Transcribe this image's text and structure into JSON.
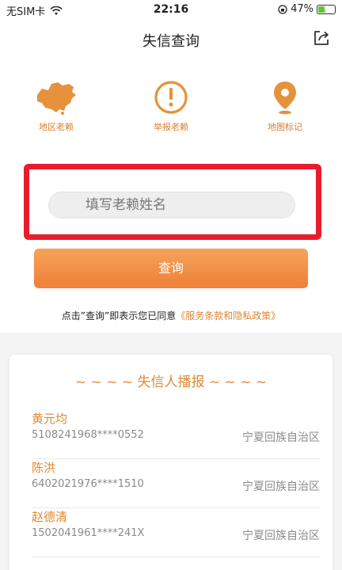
{
  "statusbar": {
    "carrier": "无SIM卡",
    "time": "22:16",
    "battery_text": "47%",
    "battery_level": 0.47,
    "icons": [
      "wifi-icon",
      "orientation-lock-icon",
      "battery-charging-icon"
    ]
  },
  "navbar": {
    "title": "失信查询",
    "share_icon": "share-icon"
  },
  "features": [
    {
      "label": "地区老赖",
      "icon": "china-map-icon"
    },
    {
      "label": "举报老赖",
      "icon": "exclamation-circle-icon"
    },
    {
      "label": "地图标记",
      "icon": "location-pin-icon"
    }
  ],
  "search": {
    "placeholder": "填写老赖姓名",
    "value": ""
  },
  "query_button": {
    "label": "查询"
  },
  "agreement": {
    "prefix": "点击”查询”即表示您已同意",
    "link": "《服务条款和隐私政策》"
  },
  "broadcast": {
    "title": "~ ~ ~ ~ 失信人播报 ~ ~ ~ ~",
    "items": [
      {
        "name": "黄元均",
        "id": "5108241968****0552",
        "region": "宁夏回族自治区"
      },
      {
        "name": "陈洪",
        "id": "6402021976****1510",
        "region": "宁夏回族自治区"
      },
      {
        "name": "赵德清",
        "id": "1502041961****241X",
        "region": "宁夏回族自治区"
      }
    ]
  },
  "colors": {
    "accent": "#e0882f",
    "button_top": "#f6a35a",
    "button_bottom": "#ef7f37",
    "highlight_border": "#e81c2c"
  }
}
